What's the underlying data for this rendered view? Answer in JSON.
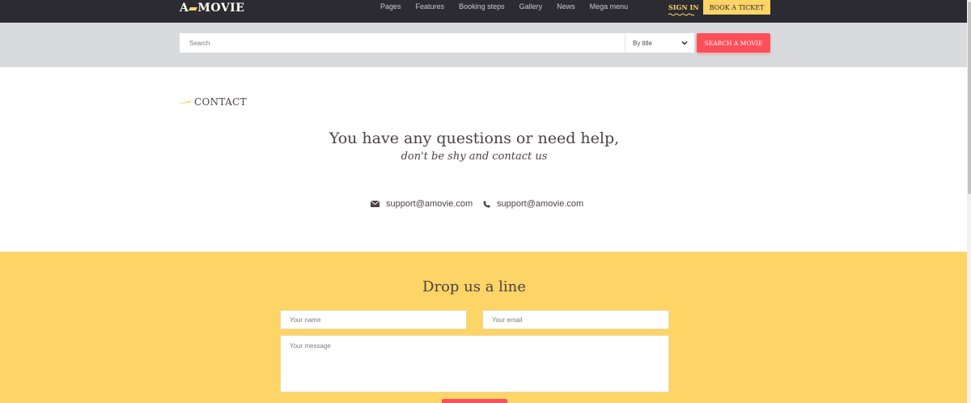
{
  "header": {
    "logo_left": "A",
    "logo_right": "MOVIE",
    "nav": [
      "Pages",
      "Features",
      "Booking steps",
      "Gallery",
      "News",
      "Mega menu"
    ],
    "sign_in": "SIGN IN",
    "book_ticket": "BOOK A TICKET"
  },
  "search": {
    "placeholder": "Search",
    "select_value": "By title",
    "button": "SEARCH A MOVIE"
  },
  "contact": {
    "label": "CONTACT",
    "headline": "You have any questions or need help,",
    "subline": "don't be shy and contact us",
    "email": "support@amovie.com",
    "phone": "support@amovie.com"
  },
  "form": {
    "title": "Drop us a line",
    "name_placeholder": "Your name",
    "email_placeholder": "Your email",
    "message_placeholder": "Your message"
  },
  "colors": {
    "accent_yellow": "#fdd466",
    "accent_red": "#fe505a",
    "dark": "#2b2b31"
  }
}
